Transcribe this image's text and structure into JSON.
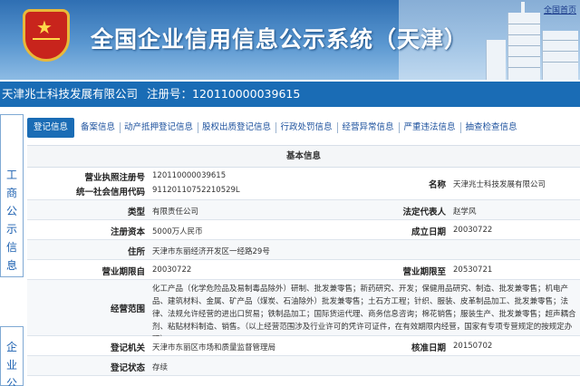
{
  "header": {
    "site_title": "全国企业信用信息公示系统（天津）",
    "home_link": "全国首页"
  },
  "company_bar": {
    "name": "天津兆士科技发展有限公司",
    "reg_label": "注册号：",
    "reg_no": "120110000039615"
  },
  "side_tabs": [
    {
      "label": [
        "工",
        "商",
        "公",
        "示",
        "信",
        "息"
      ]
    },
    {
      "label": [
        "企",
        "业",
        "公"
      ]
    }
  ],
  "tabs": [
    {
      "label": "登记信息",
      "active": true
    },
    {
      "label": "备案信息"
    },
    {
      "label": "动产抵押登记信息"
    },
    {
      "label": "股权出质登记信息"
    },
    {
      "label": "行政处罚信息"
    },
    {
      "label": "经营异常信息"
    },
    {
      "label": "严重违法信息"
    },
    {
      "label": "抽查检查信息"
    }
  ],
  "basic_info": {
    "caption": "基本信息",
    "reg_label": "营业执照注册号",
    "credit_label": "统一社会信用代码",
    "reg_value": "120110000039615",
    "credit_value": "91120110752210529L",
    "name_label": "名称",
    "name_value": "天津兆士科技发展有限公司",
    "type_label": "类型",
    "type_value": "有限责任公司",
    "legal_label": "法定代表人",
    "legal_value": "赵学风",
    "capital_label": "注册资本",
    "capital_value": "5000万人民币",
    "found_label": "成立日期",
    "found_value": "20030722",
    "address_label": "住所",
    "address_value": "天津市东丽经济开发区一经路29号",
    "term_from_label": "营业期限自",
    "term_from_value": "20030722",
    "term_to_label": "营业期限至",
    "term_to_value": "20530721",
    "scope_label": "经营范围",
    "scope_value": "化工产品（化学危险品及易制毒品除外）研制、批发兼零售；新药研究、开发；保健用品研究、制造、批发兼零售；机电产品、建筑材料、金属、矿产品（煤炭、石油除外）批发兼零售；土石方工程；针织、服装、皮革制品加工、批发兼零售；法律、法规允许经营的进出口贸易；铁制品加工；国际货运代理、商务信息咨询；棉花销售；服装生产、批发兼零售；超声耦合剂、粘贴材料制造、销售。（以上经营范围涉及行业许可的凭许可证件，在有效期限内经营，国家有专项专营规定的按规定办理）",
    "authority_label": "登记机关",
    "authority_value": "天津市东丽区市场和质量监督管理局",
    "approve_label": "核准日期",
    "approve_value": "20150702",
    "status_label": "登记状态",
    "status_value": "存续"
  }
}
